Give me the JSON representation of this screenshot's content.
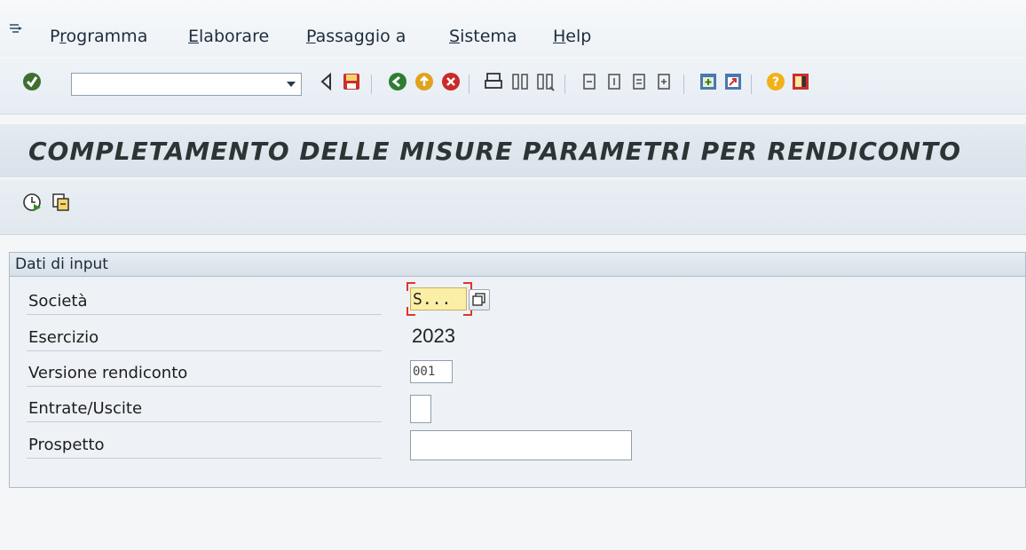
{
  "menu": {
    "items": [
      {
        "label": "Programma",
        "accel": "r",
        "pos": 1
      },
      {
        "label": "Elaborare",
        "accel": "E",
        "pos": 0
      },
      {
        "label": "Passaggio a",
        "accel": "P",
        "pos": 0
      },
      {
        "label": "Sistema",
        "accel": "S",
        "pos": 0
      },
      {
        "label": "Help",
        "accel": "H",
        "pos": 0
      }
    ]
  },
  "toolbar": {
    "command_value": "",
    "icons": [
      "enter-icon",
      "back-triangle-icon",
      "save-icon",
      "back-icon",
      "exit-icon",
      "cancel-icon",
      "print-icon",
      "find-icon",
      "find-next-icon",
      "first-page-icon",
      "previous-page-icon",
      "next-page-icon",
      "last-page-icon",
      "create-session-icon",
      "generate-shortcut-icon",
      "help-icon",
      "customize-layout-icon"
    ]
  },
  "title": "COMPLETAMENTO DELLE MISURE PARAMETRI PER RENDICONTO",
  "app_toolbar": {
    "icons": [
      "execute-icon",
      "get-variant-icon"
    ]
  },
  "group": {
    "title": "Dati di input",
    "fields": {
      "societa": {
        "label": "Società",
        "value": "S..."
      },
      "esercizio": {
        "label": "Esercizio",
        "value": "2023"
      },
      "versione": {
        "label": "Versione rendiconto",
        "value": "001"
      },
      "entrate": {
        "label": "Entrate/Uscite",
        "value": ""
      },
      "prospetto": {
        "label": "Prospetto",
        "value": ""
      }
    }
  },
  "colors": {
    "focus_field": "#fbefa7",
    "title_text": "#2d3436",
    "background": "#f4f6f8"
  }
}
